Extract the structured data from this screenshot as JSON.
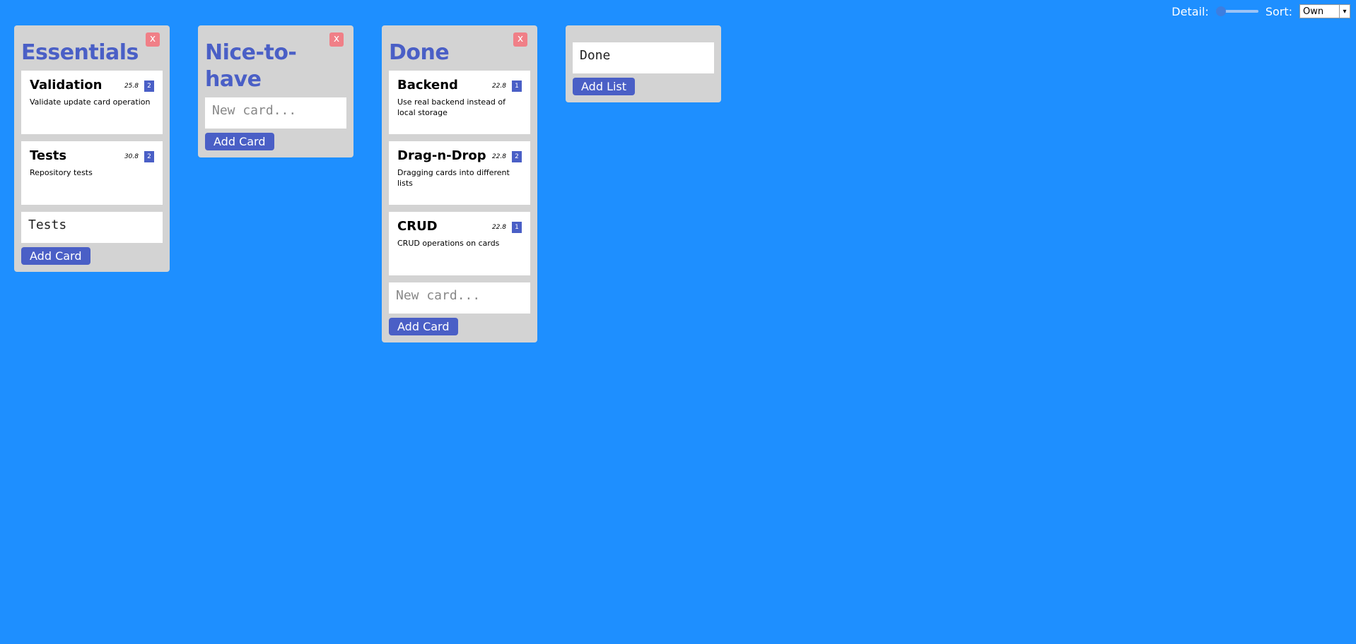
{
  "toolbar": {
    "detail_label": "Detail:",
    "detail_value": 0,
    "sort_label": "Sort:",
    "sort_value": "Own"
  },
  "lists": [
    {
      "title": "Essentials",
      "close": "x",
      "cards": [
        {
          "title": "Validation",
          "date": "25.8",
          "badge": "2",
          "desc": "Validate update card operation"
        },
        {
          "title": "Tests",
          "date": "30.8",
          "badge": "2",
          "desc": "Repository tests"
        }
      ],
      "new_card_value": "Tests",
      "new_card_placeholder": "New card...",
      "add_label": "Add Card"
    },
    {
      "title": "Nice-to-have",
      "close": "x",
      "cards": [],
      "new_card_value": "",
      "new_card_placeholder": "New card...",
      "add_label": "Add Card"
    },
    {
      "title": "Done",
      "close": "x",
      "cards": [
        {
          "title": "Backend",
          "date": "22.8",
          "badge": "1",
          "desc": "Use real backend instead of local storage"
        },
        {
          "title": "Drag-n-Drop",
          "date": "22.8",
          "badge": "2",
          "desc": "Dragging cards into different lists"
        },
        {
          "title": "CRUD",
          "date": "22.8",
          "badge": "1",
          "desc": "CRUD operations on cards"
        }
      ],
      "new_card_value": "",
      "new_card_placeholder": "New card...",
      "add_label": "Add Card"
    }
  ],
  "new_list": {
    "value": "Done",
    "add_label": "Add List"
  },
  "colors": {
    "background": "#1e8fff",
    "accent": "#4a5fc6",
    "close": "#f07f87",
    "list_bg": "#d3d3d3"
  }
}
